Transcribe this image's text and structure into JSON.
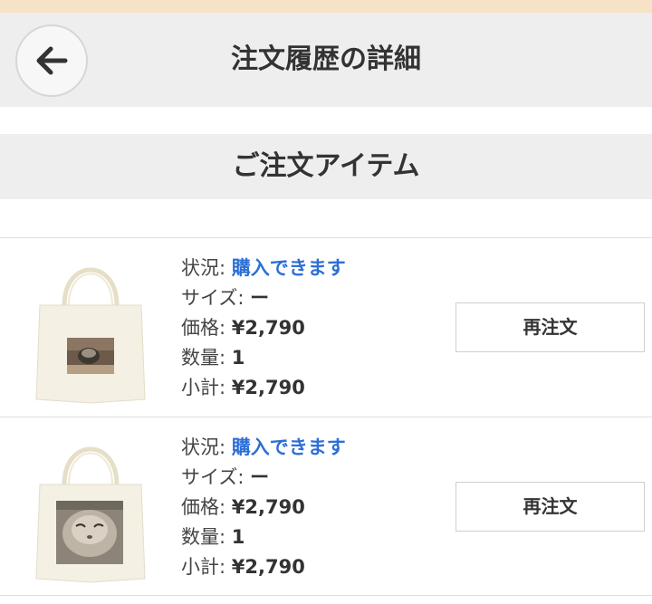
{
  "header": {
    "title": "注文履歴の詳細",
    "back_icon": "arrow-left-icon"
  },
  "section": {
    "title": "ご注文アイテム"
  },
  "items": [
    {
      "status_label": "状況:",
      "status_value": "購入できます",
      "size_label": "サイズ:",
      "size_value": "ー",
      "price_label": "価格:",
      "price_value": "¥2,790",
      "quantity_label": "数量:",
      "quantity_value": "1",
      "subtotal_label": "小計:",
      "subtotal_value": "¥2,790",
      "reorder_label": "再注文"
    },
    {
      "status_label": "状況:",
      "status_value": "購入できます",
      "size_label": "サイズ:",
      "size_value": "ー",
      "price_label": "価格:",
      "price_value": "¥2,790",
      "quantity_label": "数量:",
      "quantity_value": "1",
      "subtotal_label": "小計:",
      "subtotal_value": "¥2,790",
      "reorder_label": "再注文"
    }
  ],
  "colors": {
    "status_accent": "#2d6fd6",
    "header_bg": "#eeeeee",
    "top_strip": "#f6e2c6"
  }
}
